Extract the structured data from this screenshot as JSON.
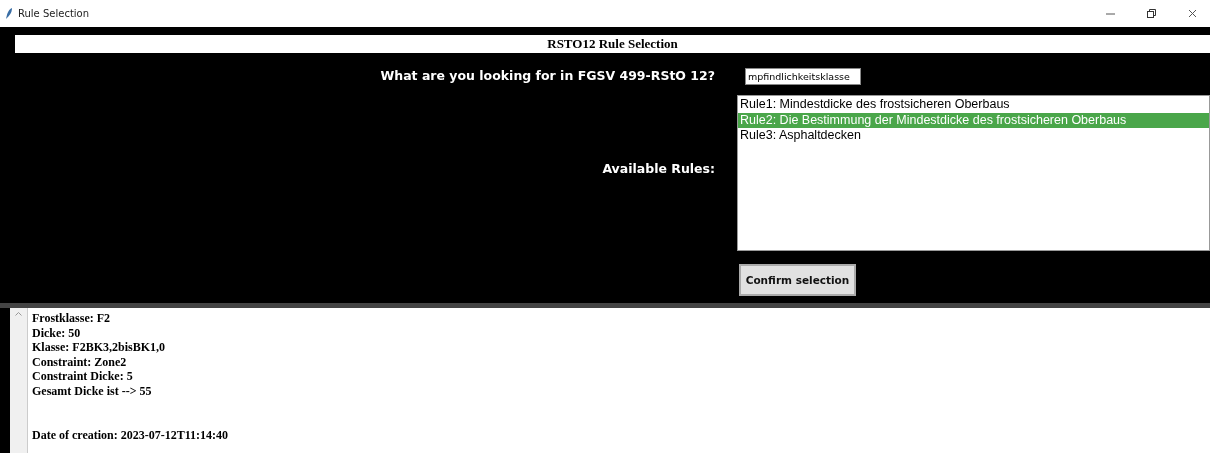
{
  "window": {
    "title": "Rule Selection"
  },
  "header": {
    "title": "RSTO12 Rule Selection"
  },
  "query": {
    "label": "What are you looking for in FGSV 499-RStO 12?",
    "value": "mpfindlichkeitsklasse"
  },
  "rules": {
    "label": "Available Rules:",
    "items": [
      {
        "text": "Rule1: Mindestdicke des frostsicheren Oberbaus",
        "selected": false
      },
      {
        "text": "Rule2: Die Bestimmung der Mindestdicke des frostsicheren Oberbaus",
        "selected": true
      },
      {
        "text": "Rule3: Asphaltdecken",
        "selected": false
      }
    ]
  },
  "confirm_button": "Confirm selection",
  "output": {
    "lines": [
      "Frostklasse: F2",
      "Dicke: 50",
      "Klasse: F2BK3,2bisBK1,0",
      "Constraint: Zone2",
      "Constraint Dicke: 5",
      "Gesamt Dicke ist --> 55"
    ],
    "date_line": "Date of creation: 2023-07-12T11:14:40"
  }
}
